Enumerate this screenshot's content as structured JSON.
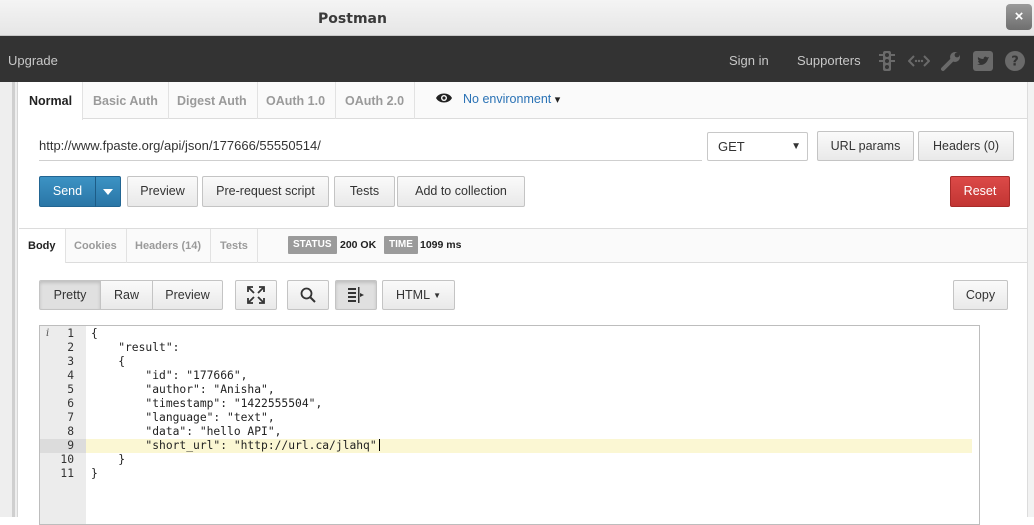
{
  "window": {
    "title": "Postman",
    "close_glyph": "×"
  },
  "header": {
    "upgrade": "Upgrade",
    "sign_in": "Sign in",
    "supporters": "Supporters",
    "icons": [
      "traffic-light-icon",
      "code-arrows-icon",
      "wrench-icon",
      "twitter-icon",
      "help-icon"
    ]
  },
  "auth_tabs": [
    "Normal",
    "Basic Auth",
    "Digest Auth",
    "OAuth 1.0",
    "OAuth 2.0"
  ],
  "active_auth_tab": "Normal",
  "environment": {
    "label": "No environment",
    "caret": "▾"
  },
  "request": {
    "url": "http://www.fpaste.org/api/json/177666/55550514/",
    "method": "GET",
    "url_params": "URL params",
    "headers_btn": "Headers (0)"
  },
  "actions": {
    "send": "Send",
    "preview": "Preview",
    "pre_request": "Pre-request script",
    "tests": "Tests",
    "add_to_collection": "Add to collection",
    "reset": "Reset"
  },
  "response_tabs": [
    "Body",
    "Cookies",
    "Headers (14)",
    "Tests"
  ],
  "active_response_tab": "Body",
  "status": {
    "status_label": "STATUS",
    "status_value": "200 OK",
    "time_label": "TIME",
    "time_value": "1099 ms"
  },
  "view_controls": {
    "pretty": "Pretty",
    "raw": "Raw",
    "preview": "Preview",
    "format": "HTML",
    "copy": "Copy"
  },
  "editor": {
    "info_marker": "i",
    "active_line": 9,
    "lines": [
      {
        "n": "1",
        "text": "{"
      },
      {
        "n": "2",
        "text": "    \"result\":"
      },
      {
        "n": "3",
        "text": "    {"
      },
      {
        "n": "4",
        "text": "        \"id\": \"177666\","
      },
      {
        "n": "5",
        "text": "        \"author\": \"Anisha\","
      },
      {
        "n": "6",
        "text": "        \"timestamp\": \"1422555504\","
      },
      {
        "n": "7",
        "text": "        \"language\": \"text\","
      },
      {
        "n": "8",
        "text": "        \"data\": \"hello API\","
      },
      {
        "n": "9",
        "text": "        \"short_url\": \"http://url.ca/jlahq\""
      },
      {
        "n": "10",
        "text": "    }"
      },
      {
        "n": "11",
        "text": "}"
      }
    ]
  }
}
